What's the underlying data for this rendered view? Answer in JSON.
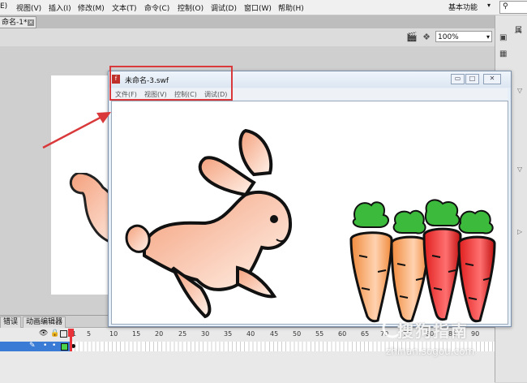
{
  "menubar": {
    "items": [
      "E)",
      "视图(V)",
      "插入(I)",
      "修改(M)",
      "文本(T)",
      "命令(C)",
      "控制(O)",
      "调试(D)",
      "窗口(W)",
      "帮助(H)"
    ],
    "workspace": "基本功能"
  },
  "document": {
    "tab_label": "命名-1*",
    "zoom": "100%"
  },
  "right_panel": {
    "label": "属"
  },
  "swf_window": {
    "title": "未命名-3.swf",
    "menu": [
      "文件(F)",
      "视图(V)",
      "控制(C)",
      "调试(D)"
    ],
    "minimize": "▭",
    "maximize": "□",
    "close": "✕"
  },
  "timeline": {
    "tabs": [
      "错误",
      "动画编辑器"
    ],
    "frame_numbers": [
      "1",
      "5",
      "10",
      "15",
      "20",
      "25",
      "30",
      "35",
      "40",
      "45",
      "50",
      "55",
      "60",
      "65",
      "70",
      "75",
      "80",
      "85",
      "90"
    ]
  },
  "watermark": {
    "main": "搜狗指南",
    "sub": "zhinan.sogou.com"
  },
  "colors": {
    "annotation": "#d9393a",
    "carrot_orange": "#f08a3c",
    "carrot_red": "#e01e1e",
    "rabbit": "#f4a07c",
    "leaf": "#3cba3c"
  }
}
